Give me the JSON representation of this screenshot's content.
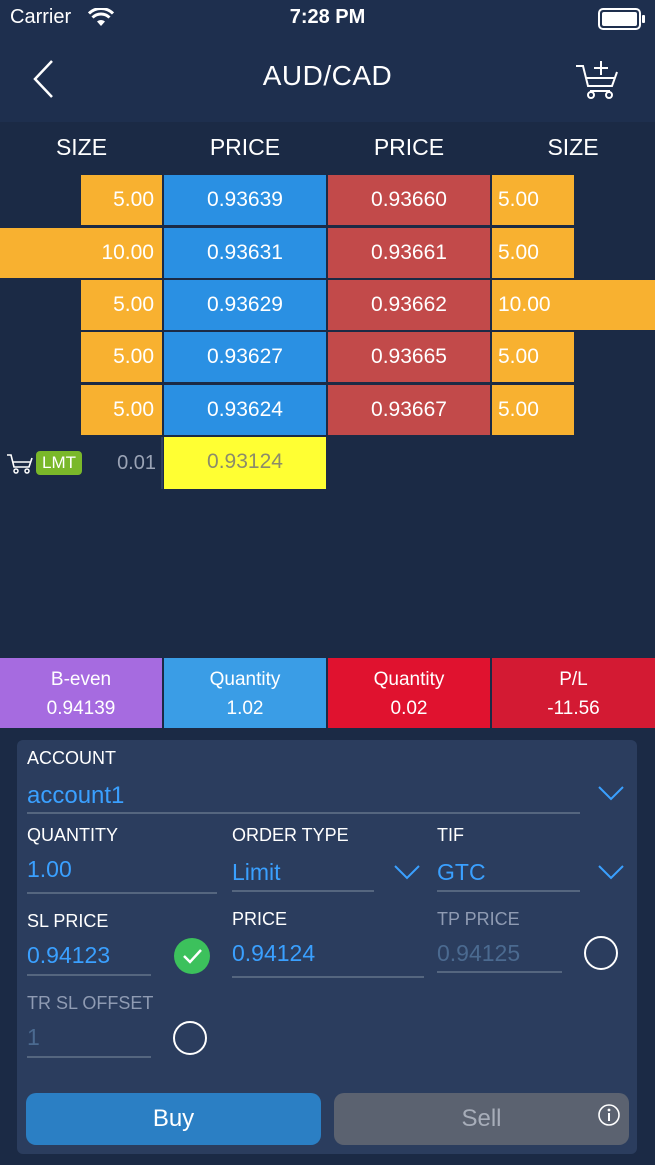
{
  "status_bar": {
    "carrier": "Carrier",
    "time": "7:28 PM"
  },
  "nav": {
    "title": "AUD/CAD",
    "back_icon": "chevron-left-icon",
    "cart_icon": "cart-add-icon"
  },
  "order_book": {
    "headers": {
      "bid_size": "SIZE",
      "bid_price": "PRICE",
      "ask_price": "PRICE",
      "ask_size": "SIZE"
    },
    "rows": [
      {
        "bid_size": "5.00",
        "bid_price": "0.93639",
        "ask_price": "0.93660",
        "ask_size": "5.00"
      },
      {
        "bid_size": "10.00",
        "bid_price": "0.93631",
        "ask_price": "0.93661",
        "ask_size": "5.00"
      },
      {
        "bid_size": "5.00",
        "bid_price": "0.93629",
        "ask_price": "0.93662",
        "ask_size": "10.00"
      },
      {
        "bid_size": "5.00",
        "bid_price": "0.93627",
        "ask_price": "0.93665",
        "ask_size": "5.00"
      },
      {
        "bid_size": "5.00",
        "bid_price": "0.93624",
        "ask_price": "0.93667",
        "ask_size": "5.00"
      }
    ],
    "pending_order": {
      "badge": "LMT",
      "size": "0.01",
      "price": "0.93124"
    }
  },
  "stats": {
    "breakeven": {
      "label": "B-even",
      "value": "0.94139"
    },
    "buy_quantity": {
      "label": "Quantity",
      "value": "1.02"
    },
    "sell_quantity": {
      "label": "Quantity",
      "value": "0.02"
    },
    "pl": {
      "label": "P/L",
      "value": "-11.56"
    }
  },
  "form": {
    "account": {
      "label": "ACCOUNT",
      "value": "account1"
    },
    "quantity": {
      "label": "QUANTITY",
      "value": "1.00"
    },
    "order_type": {
      "label": "ORDER TYPE",
      "value": "Limit"
    },
    "tif": {
      "label": "TIF",
      "value": "GTC"
    },
    "sl_price": {
      "label": "SL PRICE",
      "value": "0.94123",
      "enabled": true
    },
    "price": {
      "label": "PRICE",
      "value": "0.94124"
    },
    "tp_price": {
      "label": "TP PRICE",
      "value": "0.94125",
      "enabled": false
    },
    "tr_sl_offset": {
      "label": "TR SL OFFSET",
      "value": "1",
      "enabled": false
    },
    "buy_label": "Buy",
    "sell_label": "Sell"
  },
  "colors": {
    "background": "#1b2a45",
    "bid": "#2a90e3",
    "ask": "#c24a4a",
    "size": "#f8b130",
    "pending_price": "#ffff33",
    "breakeven": "#a66be0",
    "sell_stat": "#e0122f",
    "buy_button": "#2b7fc4",
    "sell_button": "#5b6270"
  }
}
